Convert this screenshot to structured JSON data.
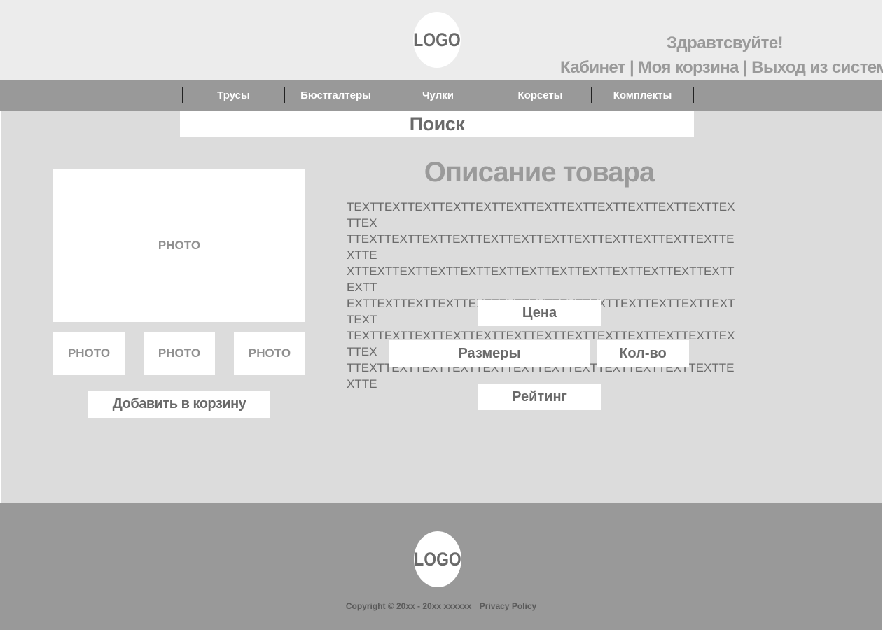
{
  "header": {
    "logo": "LOGO",
    "greeting": "Здравтсвуйте!",
    "account_links": [
      "Кабинет",
      "Моя корзина",
      "Выход из системы"
    ],
    "separator": "|"
  },
  "nav": {
    "items": [
      "Трусы",
      "Бюстгалтеры",
      "Чулки",
      "Корсеты",
      "Комплекты"
    ]
  },
  "search": {
    "label": "Поиск"
  },
  "product": {
    "photo_main": "PHOTO",
    "thumbnails": [
      "PHOTO",
      "PHOTO",
      "PHOTO"
    ],
    "add_to_cart": "Добавить в корзину",
    "description_title": "Описание товара",
    "description_lines": [
      "TEXTTEXTTEXTTEXTTEXTTEXTTEXTTEXTTEXTTEXTTEXTTEXTTEXTTEX",
      "TTEXTTEXTTEXTTEXTTEXTTEXTTEXTTEXTTEXTTEXTTEXTTEXTTEXTTE",
      "XTTEXTTEXTTEXTTEXTTEXTTEXTTEXTTEXTTEXTTEXTTEXTTEXTTEXTT",
      "EXTTEXTTEXTTEXTTEXTTEXTTEXTTEXTTEXTTEXTTEXTTEXTTEXTTEXT",
      "TEXTTEXTTEXTTEXTTEXTTEXTTEXTTEXTTEXTTEXTTEXTTEXTTEXTTEX",
      "TTEXTTEXTTEXTTEXTTEXTTEXTTEXTTEXTTEXTTEXTTEXTTEXTTEXTTE"
    ],
    "price": "Цена",
    "sizes": "Размеры",
    "quantity": "Кол-во",
    "rating": "Рейтинг"
  },
  "footer": {
    "logo": "LOGO",
    "copyright": "Copyright © 20xx - 20xx xxxxxx",
    "privacy": "Privacy Policy"
  },
  "colors": {
    "header_bg": "#ececec",
    "nav_bg": "#999999",
    "main_bg": "#dcdcdc",
    "footer_bg": "#999999",
    "text_dark": "#6a6a6a",
    "text_light": "#9a9a9a"
  }
}
